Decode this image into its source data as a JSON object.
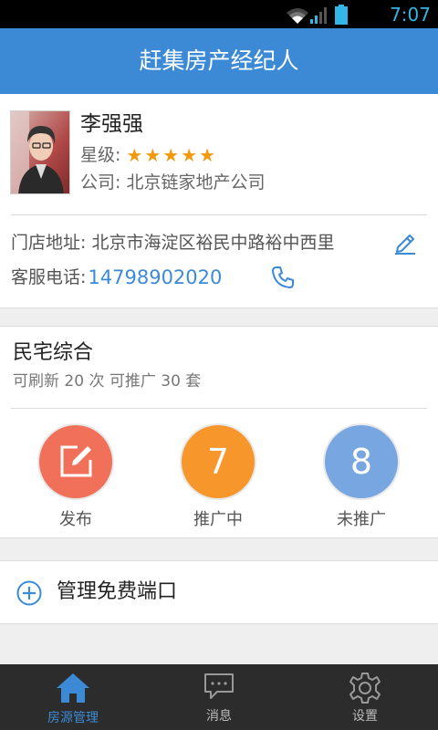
{
  "status_bar": {
    "time": "7:07"
  },
  "header": {
    "title": "赶集房产经纪人"
  },
  "profile": {
    "name": "李强强",
    "star_label": "星级:",
    "rating": 5,
    "company_label": "公司:",
    "company": "北京链家地产公司",
    "address_label": "门店地址:",
    "address": "北京市海淀区裕民中路裕中西里",
    "phone_label": "客服电话:",
    "phone": "14798902020"
  },
  "summary": {
    "title": "民宅综合",
    "subtitle": "可刷新 20 次 可推广 30 套",
    "stats": [
      {
        "label": "发布",
        "value": "",
        "color": "#f0705a",
        "icon": "edit-icon"
      },
      {
        "label": "推广中",
        "value": "7",
        "color": "#f7962b"
      },
      {
        "label": "未推广",
        "value": "8",
        "color": "#78a6e0"
      }
    ]
  },
  "manage": {
    "label": "管理免费端口",
    "icon": "plus-circle-icon"
  },
  "nav": {
    "items": [
      {
        "label": "房源管理",
        "icon": "home-icon",
        "active": true
      },
      {
        "label": "消息",
        "icon": "message-icon",
        "active": false
      },
      {
        "label": "设置",
        "icon": "gear-icon",
        "active": false
      }
    ]
  },
  "colors": {
    "accent": "#3c8ad6",
    "star": "#f29a0f",
    "nav_bg": "#2c2c2c",
    "status_time": "#33b5e5"
  }
}
